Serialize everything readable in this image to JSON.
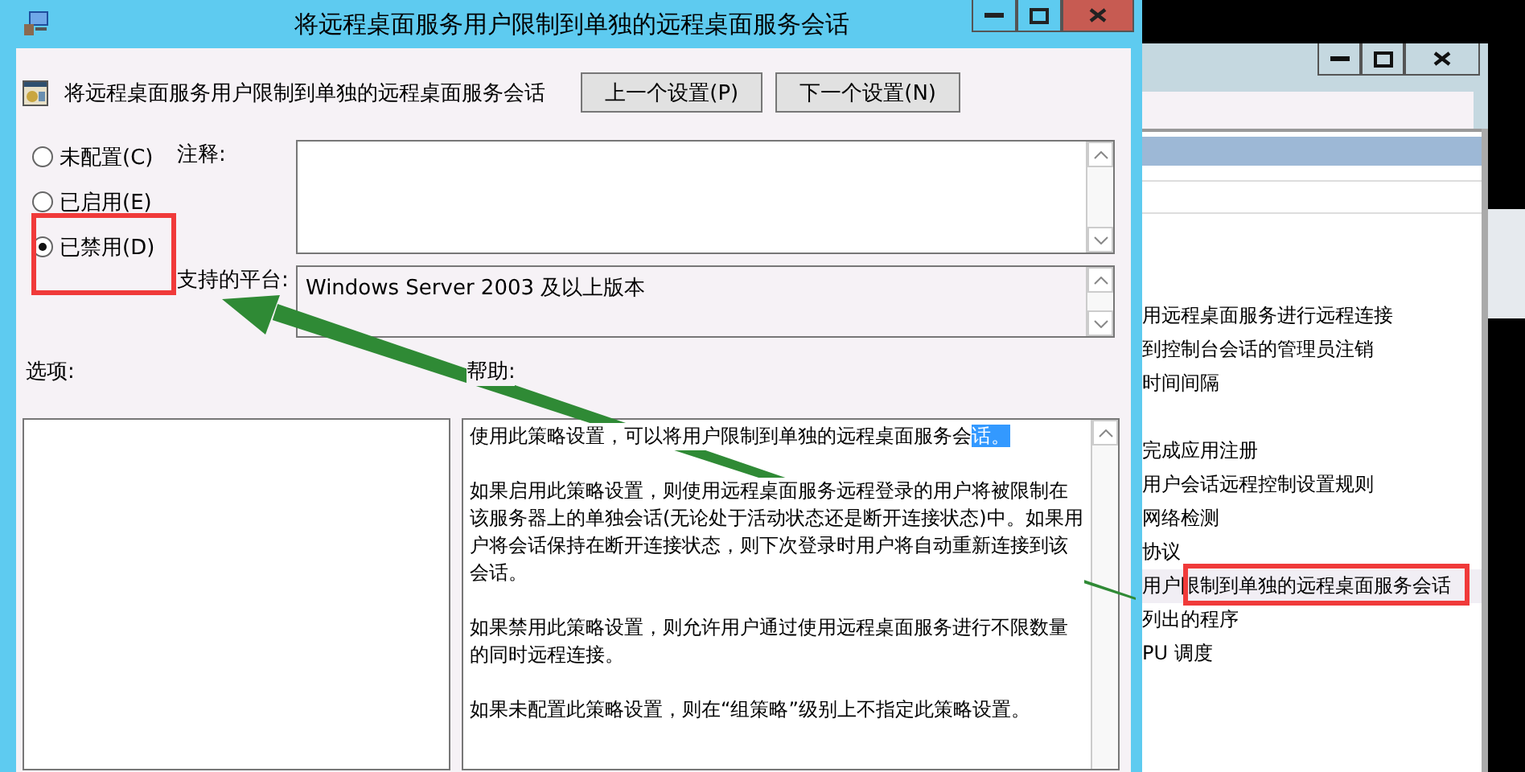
{
  "dialog": {
    "title": "将远程桌面服务用户限制到单独的远程桌面服务会话",
    "heading": "将远程桌面服务用户限制到单独的远程桌面服务会话",
    "buttons": [
      "上一个设置(P)",
      "下一个设置(N)"
    ],
    "options": [
      {
        "label": "未配置(C)",
        "selected": false
      },
      {
        "label": "已启用(E)",
        "selected": false
      },
      {
        "label": "已禁用(D)",
        "selected": true
      }
    ],
    "comment_label": "注释:",
    "platform_label": "支持的平台:",
    "platform": "Windows Server 2003 及以上版本",
    "options_label": "选项:",
    "help_label": "帮助:",
    "help": [
      [
        {
          "text": "使用此策略设置，可以将用户限制到单独的远程桌面服务会",
          "selected": false
        },
        {
          "text": "话。",
          "selected": true
        }
      ],
      [
        {
          "text": "如果启用此策略设置，则使用远程桌面服务远程登录的用户将被限制在该服务器上的单独会话(无论处于活动状态还是断开连接状态)中。如果用户将会话保持在断开连接状态，则下次登录时用户将自动重新连接到该会话。",
          "selected": false
        }
      ],
      [
        {
          "text": "如果禁用此策略设置，则允许用户通过使用远程桌面服务进行不限数量的同时远程连接。",
          "selected": false
        }
      ],
      [
        {
          "text": "如果未配置此策略设置，则在“组策略”级别上不指定此策略设置。",
          "selected": false
        }
      ]
    ]
  },
  "background_window": {
    "groups": [
      [
        {
          "text": "用远程桌面服务进行远程连接",
          "selected": false
        },
        {
          "text": "到控制台会话的管理员注销",
          "selected": false
        },
        {
          "text": "时间间隔",
          "selected": false
        }
      ],
      [
        {
          "text": "完成应用注册",
          "selected": false
        },
        {
          "text": "用户会话远程控制设置规则",
          "selected": false
        },
        {
          "text": "网络检测",
          "selected": false
        },
        {
          "text": "协议",
          "selected": false
        },
        {
          "text": "用户限制到单独的远程桌面服务会话",
          "selected": true
        },
        {
          "text": "列出的程序",
          "selected": false
        },
        {
          "text": "PU 调度",
          "selected": false
        }
      ]
    ]
  },
  "annotations": [
    {
      "kind": "box"
    },
    {
      "kind": "box"
    },
    {
      "kind": "arrow"
    }
  ]
}
